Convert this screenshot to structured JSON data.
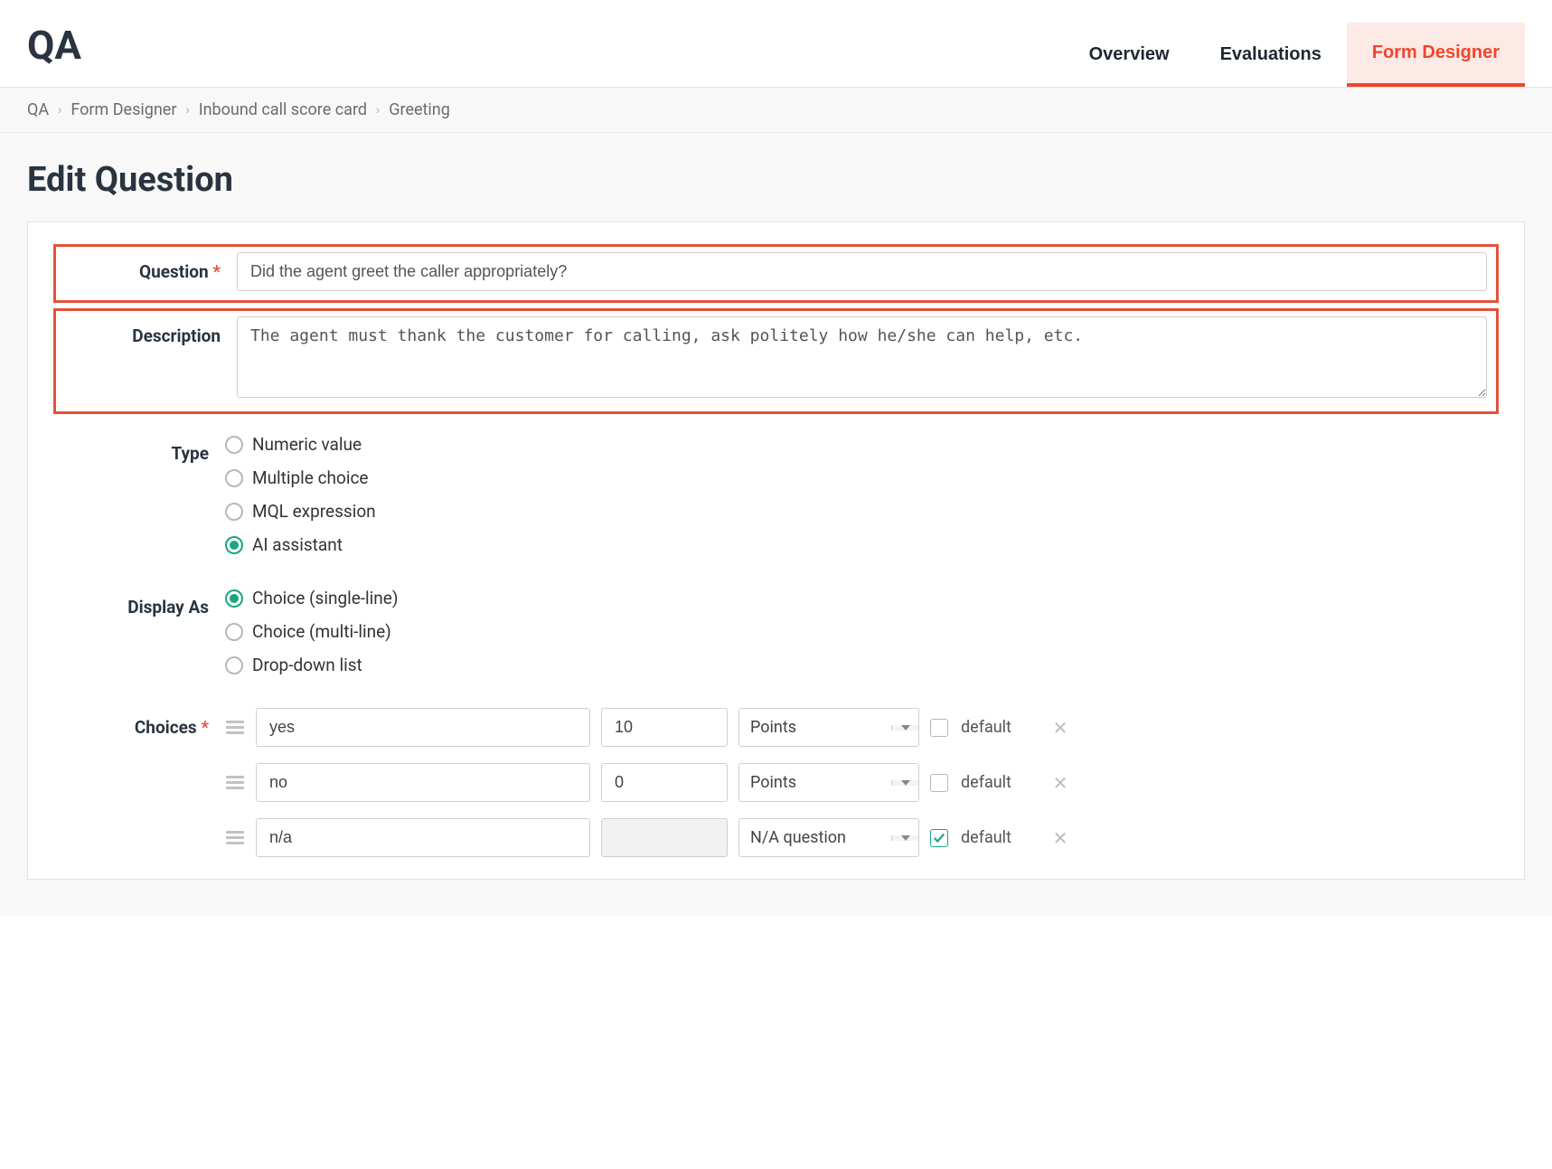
{
  "header": {
    "title": "QA",
    "tabs": [
      {
        "label": "Overview",
        "active": false
      },
      {
        "label": "Evaluations",
        "active": false
      },
      {
        "label": "Form Designer",
        "active": true
      }
    ]
  },
  "breadcrumb": [
    "QA",
    "Form Designer",
    "Inbound call score card",
    "Greeting"
  ],
  "page_title": "Edit Question",
  "form": {
    "question_label": "Question",
    "question_value": "Did the agent greet the caller appropriately?",
    "description_label": "Description",
    "description_value": "The agent must thank the customer for calling, ask politely how he/she can help, etc.",
    "type_label": "Type",
    "type_options": [
      {
        "label": "Numeric value",
        "selected": false
      },
      {
        "label": "Multiple choice",
        "selected": false
      },
      {
        "label": "MQL expression",
        "selected": false
      },
      {
        "label": "AI assistant",
        "selected": true
      }
    ],
    "display_as_label": "Display As",
    "display_as_options": [
      {
        "label": "Choice (single-line)",
        "selected": true
      },
      {
        "label": "Choice (multi-line)",
        "selected": false
      },
      {
        "label": "Drop-down list",
        "selected": false
      }
    ],
    "choices_label": "Choices",
    "default_label": "default",
    "choices": [
      {
        "label": "yes",
        "value": "10",
        "unit": "Points",
        "default": false,
        "value_disabled": false
      },
      {
        "label": "no",
        "value": "0",
        "unit": "Points",
        "default": false,
        "value_disabled": false
      },
      {
        "label": "n/a",
        "value": "",
        "unit": "N/A question",
        "default": true,
        "value_disabled": true
      }
    ]
  }
}
